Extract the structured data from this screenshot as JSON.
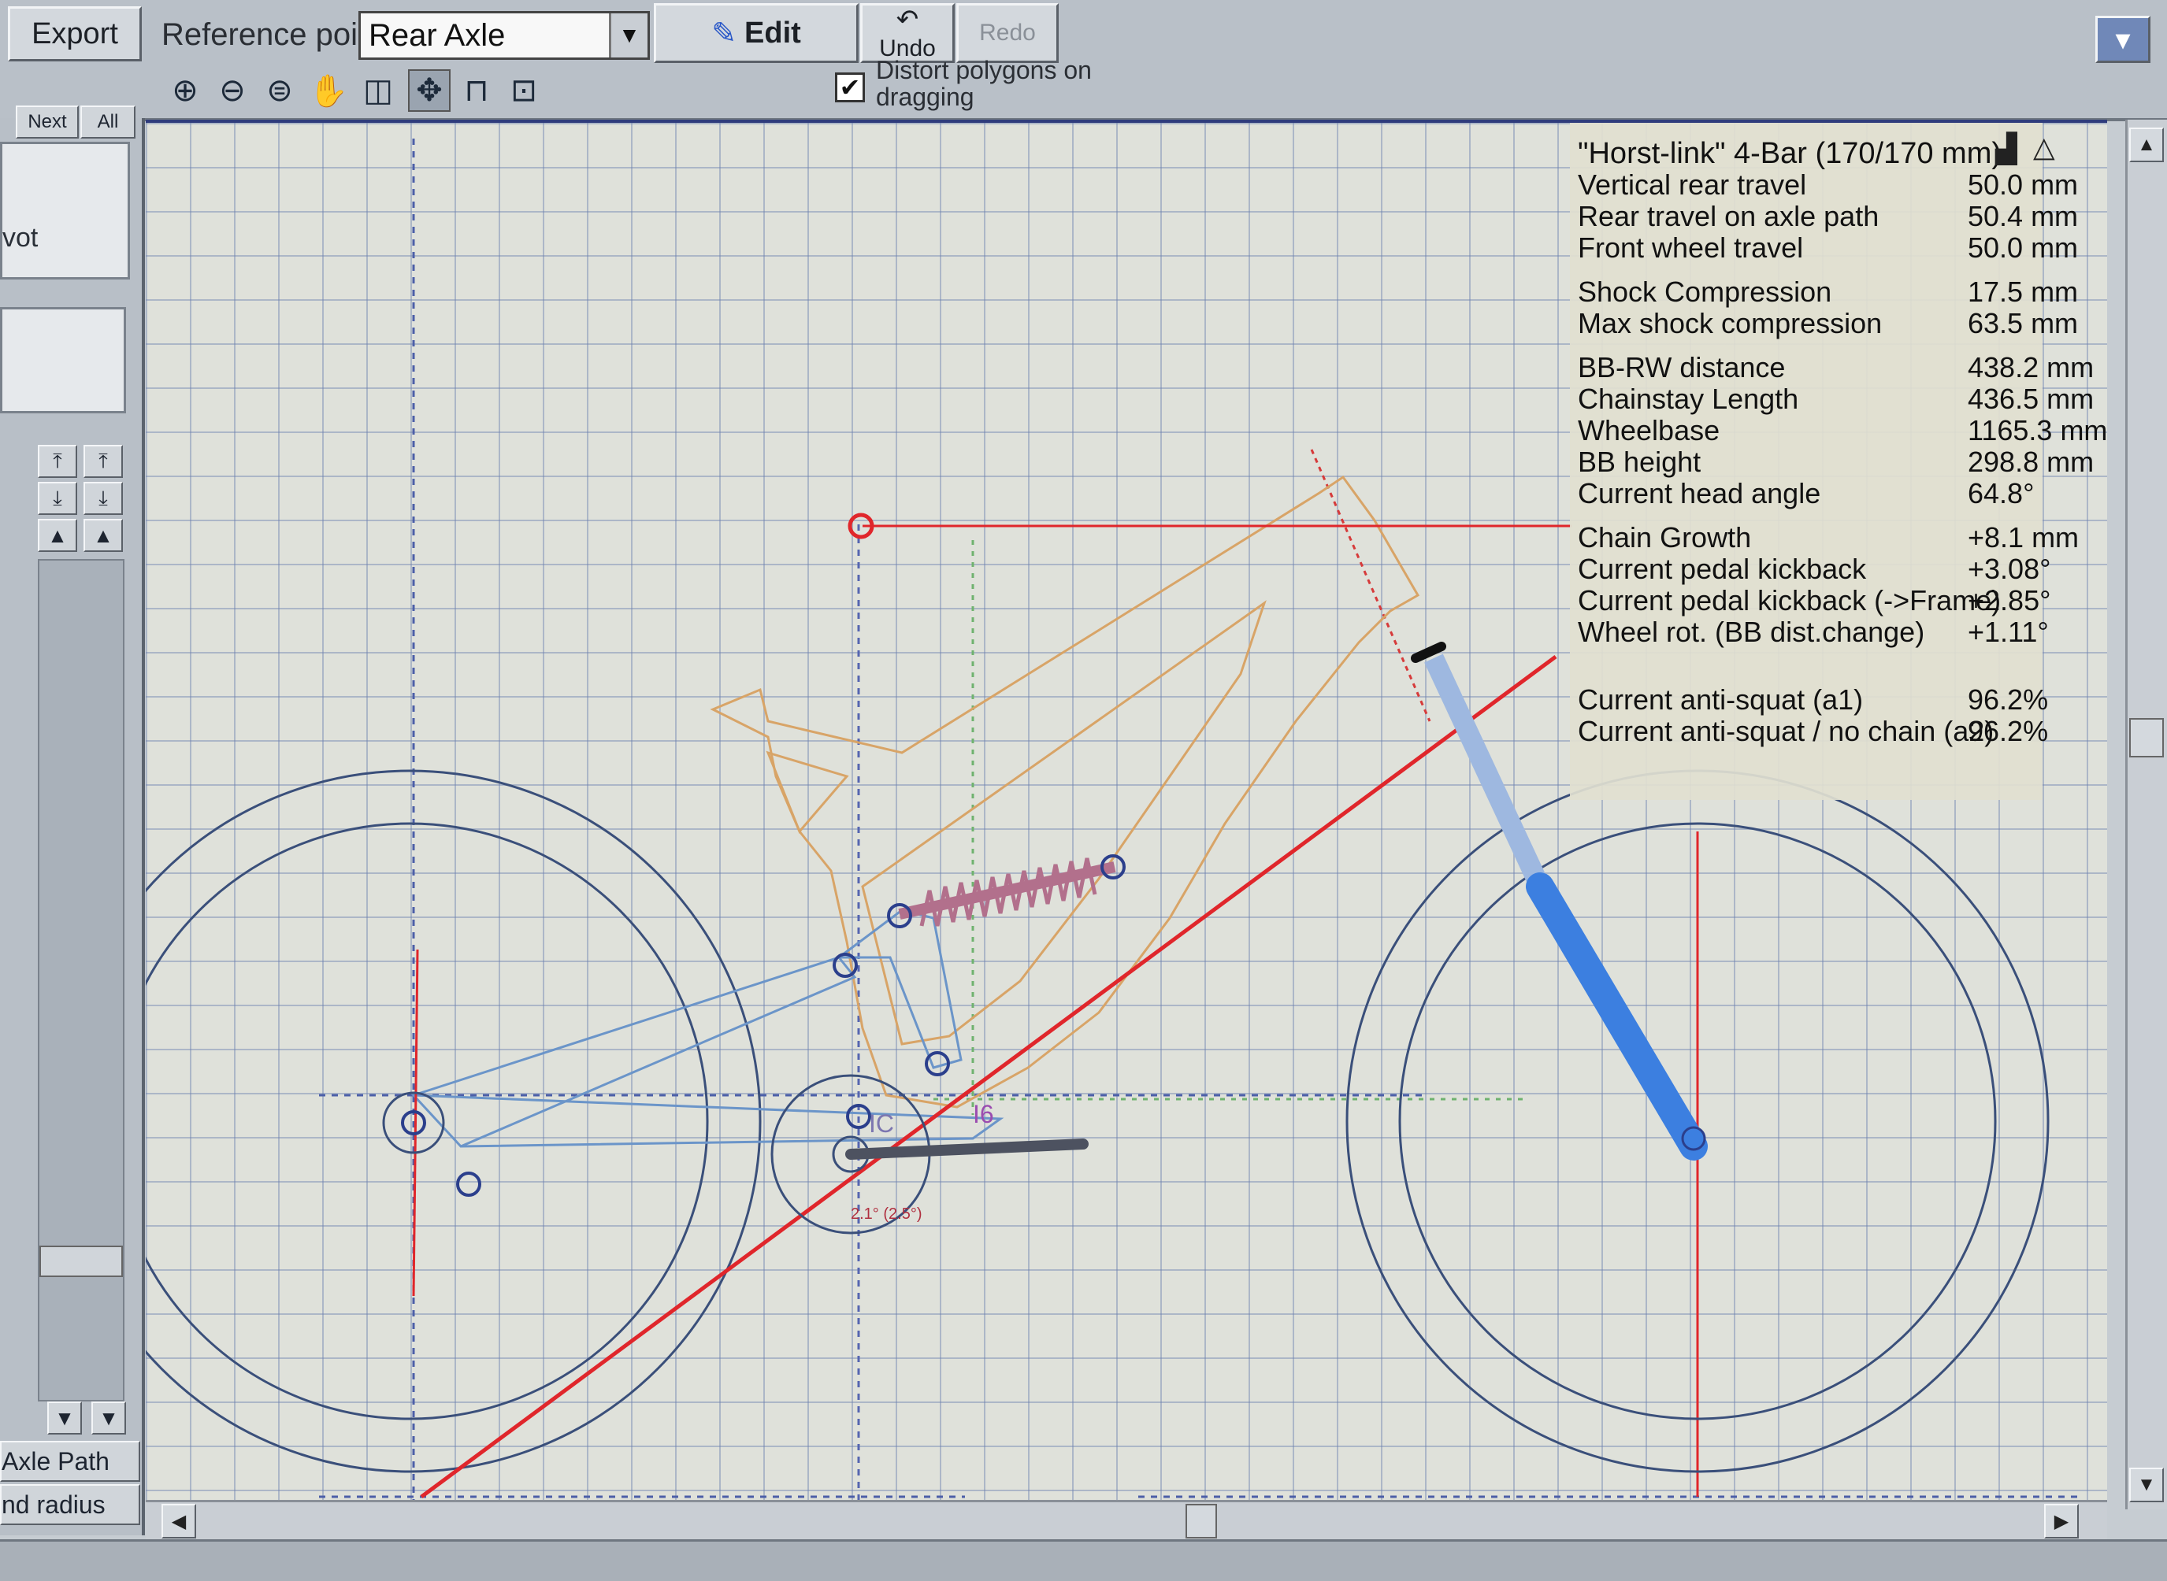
{
  "toolbar": {
    "export_label": "Export",
    "reference_point_label": "Reference point",
    "reference_point_value": "Rear Axle",
    "edit_label": "Edit",
    "undo_label": "Undo",
    "redo_label": "Redo",
    "distort_label_line1": "Distort polygons on",
    "distort_label_line2": "dragging",
    "distort_checked": "✔",
    "icons": [
      "zoom-in-icon",
      "zoom-out-icon",
      "zoom-fit-icon",
      "hand-pan-icon",
      "split-view-icon",
      "move-icon",
      "measure-icon",
      "pointer-icon"
    ]
  },
  "left_panel": {
    "tab_next": "Next",
    "tab_all": "All",
    "pivot_text": "vot",
    "axle_path_label": "Axle Path",
    "end_radius_label": "nd radius"
  },
  "info_panel": {
    "title": "\"Horst-link\" 4-Bar (170/170 mm)",
    "rows": [
      {
        "label": "Vertical rear travel",
        "value": "50.0 mm"
      },
      {
        "label": "Rear travel on axle path",
        "value": "50.4 mm"
      },
      {
        "label": "Front wheel travel",
        "value": "50.0 mm"
      },
      {
        "label": "Shock Compression",
        "value": "17.5 mm"
      },
      {
        "label": "Max shock compression",
        "value": "63.5 mm"
      },
      {
        "label": "BB-RW distance",
        "value": "438.2 mm"
      },
      {
        "label": "Chainstay Length",
        "value": "436.5 mm"
      },
      {
        "label": "Wheelbase",
        "value": "1165.3 mm"
      },
      {
        "label": "BB height",
        "value": "298.8 mm"
      },
      {
        "label": "Current head angle",
        "value": "64.8°"
      },
      {
        "label": "Chain Growth",
        "value": "+8.1 mm"
      },
      {
        "label": "Current pedal kickback",
        "value": "+3.08°"
      },
      {
        "label": "Current pedal kickback (->Frame)",
        "value": "+2.85°"
      },
      {
        "label": "Wheel rot. (BB dist.change)",
        "value": "+1.11°"
      },
      {
        "label": "Current anti-squat (a1)",
        "value": "96.2%"
      },
      {
        "label": "Current anti-squat / no chain (a2)",
        "value": "96.2%"
      }
    ]
  },
  "canvas_labels": {
    "ic_label": "IC",
    "i6_label": "I6",
    "chainring_label": "2.1° (2.5°)"
  },
  "colors": {
    "frame": "#d8a467",
    "links": "#6b95c9",
    "anti_squat_line": "#e0262b",
    "fork": "#3c7fe0",
    "shock": "#b2708c",
    "wheels": "#3a4f7a"
  }
}
